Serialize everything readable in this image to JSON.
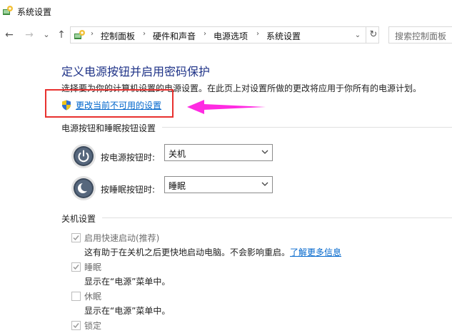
{
  "window": {
    "title": "系统设置"
  },
  "nav": {
    "back_icon": "←",
    "forward_icon": "→",
    "recent_icon": "⌄",
    "up_icon": "↑",
    "breadcrumb": [
      "控制面板",
      "硬件和声音",
      "电源选项",
      "系统设置"
    ],
    "separator": "›",
    "dropdown_icon": "⌄",
    "refresh_icon": "↻",
    "search_placeholder": "搜索控制面板"
  },
  "main": {
    "title": "定义电源按钮并启用密码保护",
    "description": "选择要为你的计算机设置的电源设置。在此页上对设置所做的更改将应用于你所有的电源计划。",
    "change_link": "更改当前不可用的设置"
  },
  "power_section": {
    "title": "电源按钮和睡眠按钮设置",
    "rows": [
      {
        "label": "按电源按钮时:",
        "value": "关机",
        "icon": "power-icon"
      },
      {
        "label": "按睡眠按钮时:",
        "value": "睡眠",
        "icon": "sleep-moon-icon"
      }
    ]
  },
  "shutdown_section": {
    "title": "关机设置",
    "options": [
      {
        "label": "启用快速启动(推荐)",
        "checked": true,
        "description": "这有助于在关机之后更快地启动电脑。不会影响重启。",
        "link": "了解更多信息"
      },
      {
        "label": "睡眠",
        "checked": true,
        "description": "显示在“电源”菜单中。"
      },
      {
        "label": "休眠",
        "checked": false,
        "description": "显示在“电源”菜单中。"
      },
      {
        "label": "锁定",
        "checked": true,
        "description": ""
      }
    ]
  },
  "colors": {
    "title_blue": "#1e3287",
    "link_blue": "#0066cc",
    "highlight_red": "#e8312f",
    "arrow_magenta": "#ff2be2"
  }
}
